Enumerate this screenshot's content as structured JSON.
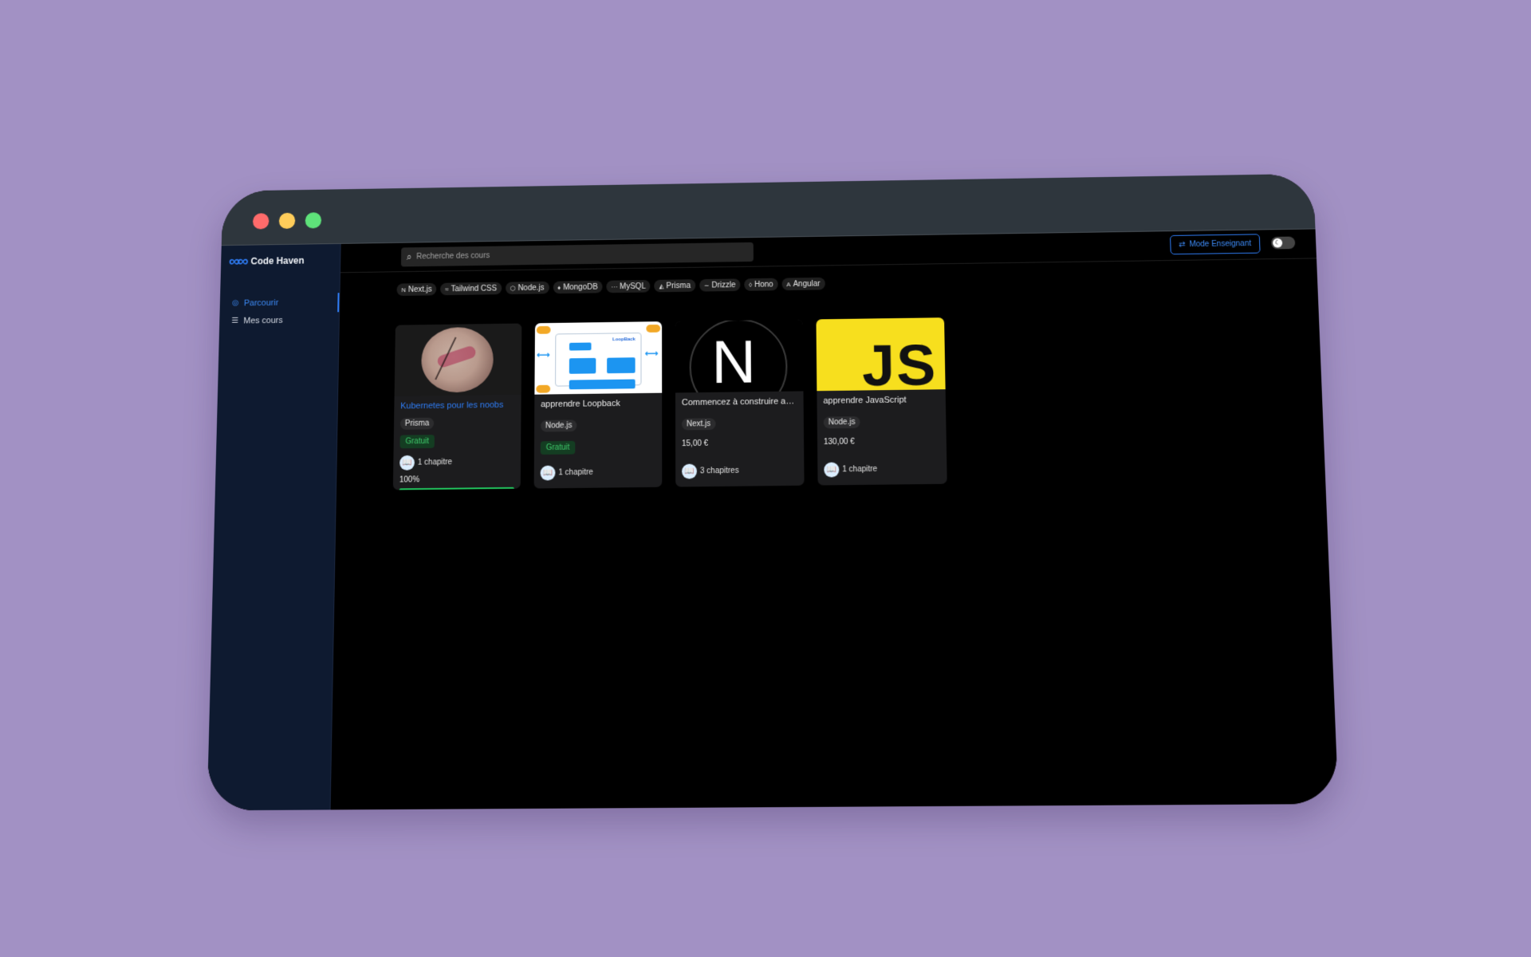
{
  "brand": {
    "name": "Code Haven",
    "logo_glyph": "∞∞"
  },
  "sidebar": {
    "items": [
      {
        "label": "Parcourir",
        "icon": "compass-icon",
        "glyph": "◎",
        "active": true
      },
      {
        "label": "Mes cours",
        "icon": "list-icon",
        "glyph": "☰",
        "active": false
      }
    ]
  },
  "search": {
    "placeholder": "Recherche des cours",
    "glyph": "⌕"
  },
  "header": {
    "teacher_mode_label": "Mode Enseignant",
    "teacher_icon": "⇄"
  },
  "theme_toggle": {
    "glyph": "☾"
  },
  "categories": [
    {
      "label": "Next.js",
      "glyph": "N"
    },
    {
      "label": "Tailwind CSS",
      "glyph": "≈"
    },
    {
      "label": "Node.js",
      "glyph": "⬡"
    },
    {
      "label": "MongoDB",
      "glyph": "♦"
    },
    {
      "label": "MySQL",
      "glyph": "⋯"
    },
    {
      "label": "Prisma",
      "glyph": "◭"
    },
    {
      "label": "Drizzle",
      "glyph": "∼"
    },
    {
      "label": "Hono",
      "glyph": "◊"
    },
    {
      "label": "Angular",
      "glyph": "A"
    }
  ],
  "courses": [
    {
      "title": "Kubernetes pour les noobs",
      "tag": "Prisma",
      "price_label": "Gratuit",
      "chapters": "1 chapitre",
      "progress_label": "100%",
      "progress": 1.0
    },
    {
      "title": "apprendre Loopback",
      "tag": "Node.js",
      "price_label": "Gratuit",
      "chapters": "1 chapitre",
      "logo_text": "LoopBack"
    },
    {
      "title": "Commencez à construire ave...",
      "tag": "Next.js",
      "price": "15,00 €",
      "chapters": "3 chapitres",
      "logo_text": "N"
    },
    {
      "title": "apprendre JavaScript",
      "tag": "Node.js",
      "price": "130,00 €",
      "chapters": "1 chapitre",
      "logo_text": "JS"
    }
  ],
  "colors": {
    "accent": "#2f7df6",
    "sidebar_bg": "#0e1a30",
    "success": "#22c55e",
    "background": "#a291c4"
  }
}
